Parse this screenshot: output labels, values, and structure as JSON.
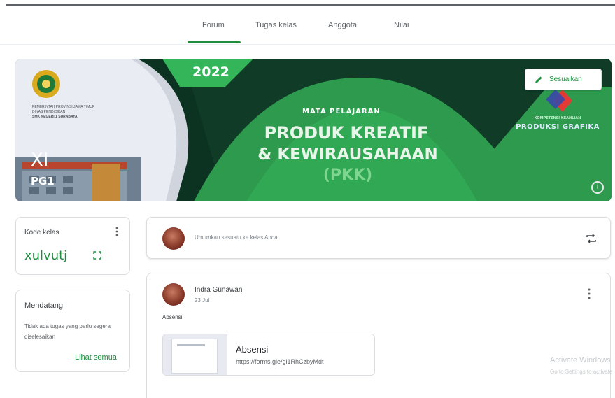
{
  "tabs": [
    {
      "label": "Forum",
      "active": true
    },
    {
      "label": "Tugas kelas",
      "active": false
    },
    {
      "label": "Anggota",
      "active": false
    },
    {
      "label": "Nilai",
      "active": false
    }
  ],
  "banner": {
    "year": "2022",
    "subject_label": "MATA PELAJARAN",
    "title_line1": "PRODUK KREATIF",
    "title_line2": "& KEWIRAUSAHAAN",
    "title_line3": "(PKK)",
    "class_name": "XI",
    "class_group": "PG1",
    "department_small": "KOMPETENSI KEAHLIAN",
    "department": "PRODUKSI GRAFIKA",
    "school_lines": [
      "PEMERINTAH PROVINSI JAWA TIMUR",
      "DINAS PENDIDIKAN",
      "SMK NEGERI 1 SURABAYA"
    ],
    "customize_label": "Sesuaikan",
    "info_symbol": "i",
    "colors": {
      "dark": "#0c3321",
      "green": "#2e9a4d",
      "light_green": "#34b55a",
      "accent": "#1e8e3e"
    }
  },
  "class_code": {
    "label": "Kode kelas",
    "value": "xulvutj"
  },
  "upcoming": {
    "title": "Mendatang",
    "text": "Tidak ada tugas yang perlu segera diselesaikan",
    "link": "Lihat semua"
  },
  "post_box": {
    "placeholder": "Umumkan sesuatu ke kelas Anda"
  },
  "announcement": {
    "author": "Indra Gunawan",
    "date": "23 Jul",
    "text": "Absensi",
    "attachment_title": "Absensi",
    "attachment_url": "https://forms.gle/gi1RhCzbyMdt"
  },
  "watermark": {
    "line1": "Activate Windows",
    "line2": "Go to Settings to activate"
  }
}
